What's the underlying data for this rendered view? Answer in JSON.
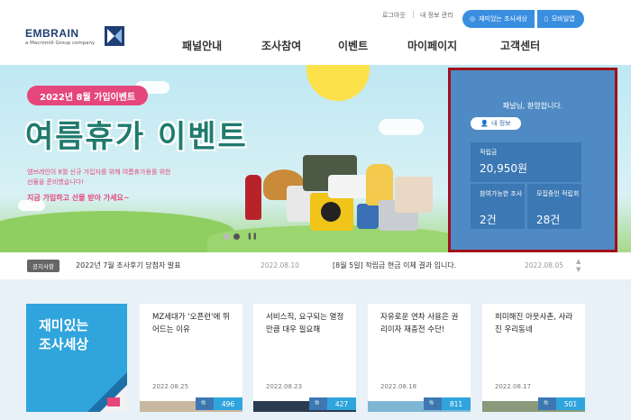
{
  "header": {
    "logo": {
      "name": "EMBRAIN",
      "tagline": "a Macromill Group company"
    },
    "util_links": [
      "로그아웃",
      "내 정보 관리"
    ],
    "pills": [
      {
        "icon": "chat-icon",
        "label": "재미있는 조사세상"
      },
      {
        "icon": "mobile-icon",
        "label": "모바일앱"
      }
    ],
    "nav": [
      "패널안내",
      "조사참여",
      "이벤트",
      "마이페이지",
      "고객센터"
    ]
  },
  "banner": {
    "badge": "2022년 8월 가입이벤트",
    "title": "여름휴가 이벤트",
    "desc_lines": [
      "엠브레인이 8월 신규 가입자를 위해 여름휴가용를 위한",
      "선물을 준비했습니다!"
    ],
    "cta": "지금 가입하고 선물 받아 가세요~",
    "slides": 2,
    "active_slide": 2,
    "pause_icon": "pause-icon"
  },
  "user_panel": {
    "welcome": "패널님, 환영합니다.",
    "myinfo_label": "내 정보",
    "points_label": "적립금",
    "points_value": "20,950원",
    "available_label": "참여가능한 조사",
    "available_value": "2건",
    "collected_label": "모집중인 적립회",
    "collected_value": "28건",
    "accent_border": "#a0101a"
  },
  "notice": {
    "tag": "공지사항",
    "items": [
      {
        "text": "2022년 7월 조사후기 당첨자 발표",
        "date": "2022.08.10"
      },
      {
        "text": "[8월 5일] 적립금 현금 이체 결과 입니다.",
        "date": "2022.08.05"
      }
    ]
  },
  "feature": {
    "title_lines": [
      "재미있는",
      "조사세상"
    ]
  },
  "cards": [
    {
      "title": "MZ세대가 '오픈런'에 뛰어드는 이유",
      "date": "2022.08.25",
      "views": "496"
    },
    {
      "title": "서비스직, 요구되는 열정만큼 대우 필요해",
      "date": "2022.08.23",
      "views": "427"
    },
    {
      "title": "자유로운 연차 사용은 권리이자 재충전 수단!",
      "date": "2022.08.18",
      "views": "811"
    },
    {
      "title": "희미해진 아웃사촌, 사라진 우리동네",
      "date": "2022.08.17",
      "views": "501"
    }
  ]
}
